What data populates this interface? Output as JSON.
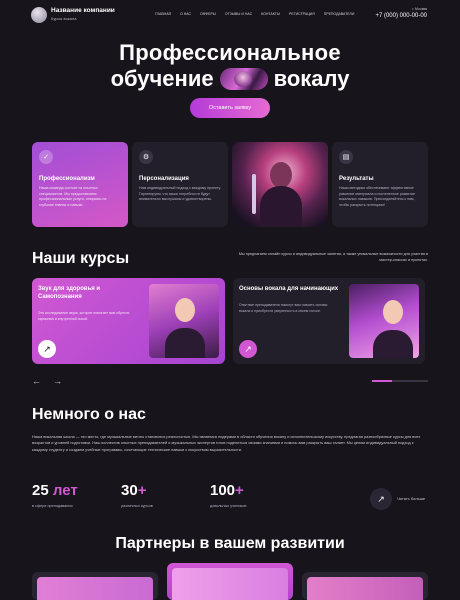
{
  "header": {
    "company_name": "Название компании",
    "company_sub": "Курсы вокала",
    "nav": [
      "ГЛАВНАЯ",
      "О НАС",
      "ОФФЕРЫ",
      "ОТЗЫВЫ И НАС",
      "КОНТАКТЫ",
      "РЕГИСТРАЦИЯ",
      "ПРЕПОДАВАТЕЛИ"
    ],
    "city": "г. Москва",
    "phone": "+7 (000) 000-00-00"
  },
  "hero": {
    "title_line1": "Профессиональное",
    "title_line2_a": "обучение",
    "title_line2_b": "вокалу",
    "cta": "Оставить заявку"
  },
  "features": [
    {
      "icon": "check-badge-icon",
      "title": "Профессионализм",
      "text": "Наша команда состоит из опытных специалистов. Мы предоставляем профессиональные услуги, опираясь на глубокие знания и навыки."
    },
    {
      "icon": "person-settings-icon",
      "title": "Персонализация",
      "text": "Нам индивидуальный подход к каждому проекту. Гарантируем, что ваши потребности будут внимательно выслушаны и удовлетворены."
    },
    {
      "icon": "results-chart-icon",
      "title": "Результаты",
      "text": "Наши методики обеспечивают эффективное усвоение материала и постепенное развитие вокальных навыков. Присоединяйтесь к нам, чтобы раскрыть потенциал!"
    }
  ],
  "courses": {
    "title": "Наши курсы",
    "description": "Мы предлагаем онлайн курсы и индивидуальные занятия, а также уникальные возможности для участия в мастер-классах и проектах.",
    "items": [
      {
        "title": "Звук для здоровья и Самопознания",
        "text": "Это исследование звука, которое помогает вам обрести гармонию и внутренний покой."
      },
      {
        "title": "Основы вокала для начинающих",
        "text": "Опытные преподаватели помогут вам освоить основы вокала и приобрести уверенность в своем голосе."
      }
    ],
    "slider_progress": 0.35
  },
  "about": {
    "title": "Немного о нас",
    "text": "Наша вокальная школа — это место, где музыкальные мечты становятся реальностью. Мы являемся лидерами в области обучения вокалу и исполнительскому искусству, предлагая разнообразные курсы для всех возрастов и уровней подготовки. Наш коллектив опытных преподавателей и музыкальных экспертов готов поделиться своими знаниями и помочь вам раскрыть ваш талант. Мы ценим индивидуальный подход к каждому студенту и создаем учебные программы, сочетающие технические навыки с искусством выразительности.",
    "stats": [
      {
        "num": "25",
        "accent": "лет",
        "label": "в сфере преподавания"
      },
      {
        "num": "30",
        "accent": "+",
        "label": "различных курсов"
      },
      {
        "num": "100",
        "accent": "+",
        "label": "довольных учеников"
      }
    ],
    "more": "Читать больше"
  },
  "partners": {
    "title": "Партнеры в вашем развитии"
  },
  "colors": {
    "accent": "#d158d2",
    "background": "#17141c",
    "card": "#221e2a"
  }
}
